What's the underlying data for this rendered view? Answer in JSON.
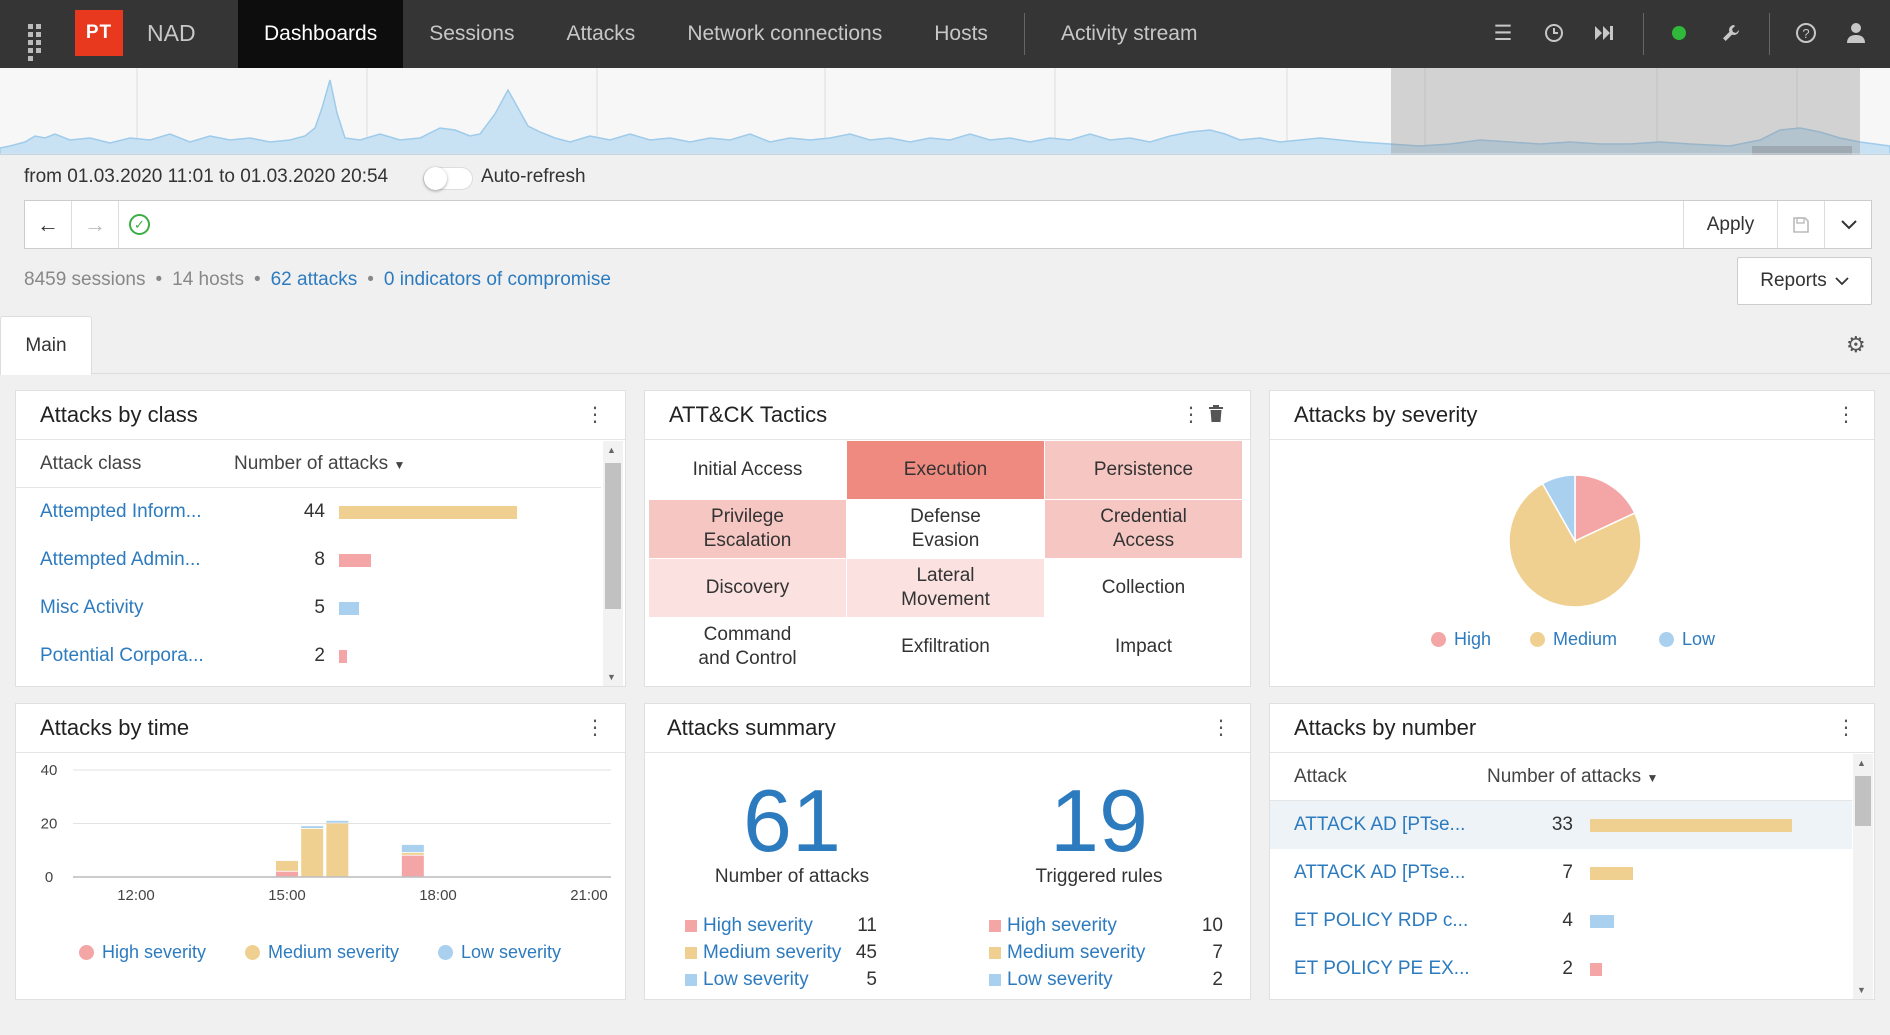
{
  "app": {
    "logo": "PT",
    "name": "NAD"
  },
  "nav": {
    "tabs": [
      "Dashboards",
      "Sessions",
      "Attacks",
      "Network connections",
      "Hosts"
    ],
    "activity": "Activity stream"
  },
  "timerange": {
    "text": "from 01.03.2020 11:01 to 01.03.2020 20:54",
    "auto_refresh": "Auto-refresh"
  },
  "query": {
    "apply": "Apply"
  },
  "stats": {
    "sessions": "8459 sessions",
    "hosts": "14 hosts",
    "attacks": "62 attacks",
    "ioc": "0 indicators of compromise",
    "sep": "•"
  },
  "reports": "Reports",
  "tab_main": "Main",
  "colors": {
    "high": "#f4a5a5",
    "medium": "#f0d090",
    "low": "#a9d0ef",
    "link": "#2d7bbf",
    "brand": "#e8381e"
  },
  "attacks_by_class": {
    "title": "Attacks by class",
    "col1": "Attack class",
    "col2": "Number of attacks",
    "rows": [
      {
        "name": "Attempted Inform...",
        "count": 44,
        "severity": "medium"
      },
      {
        "name": "Attempted Admin...",
        "count": 8,
        "severity": "high"
      },
      {
        "name": "Misc Activity",
        "count": 5,
        "severity": "low"
      },
      {
        "name": "Potential Corpora...",
        "count": 2,
        "severity": "high"
      }
    ]
  },
  "attck": {
    "title": "ATT&CK Tactics",
    "cells": [
      {
        "label": "Initial Access",
        "level": 0
      },
      {
        "label": "Execution",
        "level": 3
      },
      {
        "label": "Persistence",
        "level": 2
      },
      {
        "label": "Privilege\nEscalation",
        "level": 2
      },
      {
        "label": "Defense\nEvasion",
        "level": 0
      },
      {
        "label": "Credential\nAccess",
        "level": 2
      },
      {
        "label": "Discovery",
        "level": 1
      },
      {
        "label": "Lateral\nMovement",
        "level": 1
      },
      {
        "label": "Collection",
        "level": 0
      },
      {
        "label": "Command\nand Control",
        "level": 0
      },
      {
        "label": "Exfiltration",
        "level": 0
      },
      {
        "label": "Impact",
        "level": 0
      }
    ]
  },
  "severity_pie": {
    "title": "Attacks by severity",
    "legend": [
      "High",
      "Medium",
      "Low"
    ],
    "values": [
      11,
      45,
      5
    ]
  },
  "attacks_by_time": {
    "title": "Attacks by time",
    "yticks": [
      "40",
      "20",
      "0"
    ],
    "xticks": [
      "12:00",
      "15:00",
      "18:00",
      "21:00"
    ],
    "legend": [
      "High severity",
      "Medium severity",
      "Low severity"
    ],
    "chart_data": {
      "type": "bar",
      "stacked": true,
      "ylim": [
        0,
        40
      ],
      "x": [
        "15:00",
        "15:30",
        "16:00",
        "17:30"
      ],
      "series": [
        {
          "name": "High severity",
          "values": [
            2,
            0,
            0,
            8
          ]
        },
        {
          "name": "Medium severity",
          "values": [
            4,
            18,
            20,
            1
          ]
        },
        {
          "name": "Low severity",
          "values": [
            0,
            1,
            1,
            3
          ]
        }
      ]
    }
  },
  "summary": {
    "title": "Attacks summary",
    "attacks_num": "61",
    "attacks_label": "Number of attacks",
    "rules_num": "19",
    "rules_label": "Triggered rules",
    "attacks_sev": [
      {
        "label": "High severity",
        "value": "11"
      },
      {
        "label": "Medium severity",
        "value": "45"
      },
      {
        "label": "Low severity",
        "value": "5"
      }
    ],
    "rules_sev": [
      {
        "label": "High severity",
        "value": "10"
      },
      {
        "label": "Medium severity",
        "value": "7"
      },
      {
        "label": "Low severity",
        "value": "2"
      }
    ]
  },
  "attacks_by_number": {
    "title": "Attacks by number",
    "col1": "Attack",
    "col2": "Number of attacks",
    "rows": [
      {
        "name": "ATTACK AD [PTse...",
        "count": 33,
        "severity": "medium"
      },
      {
        "name": "ATTACK AD [PTse...",
        "count": 7,
        "severity": "medium"
      },
      {
        "name": "ET POLICY RDP c...",
        "count": 4,
        "severity": "low"
      },
      {
        "name": "ET POLICY PE EX...",
        "count": 2,
        "severity": "high"
      }
    ]
  }
}
